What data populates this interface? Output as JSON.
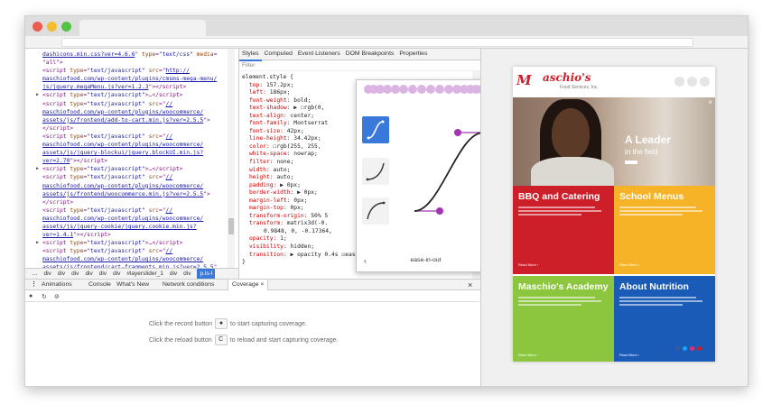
{
  "dom_lines": [
    {
      "tri": false,
      "html": "<span class='u'>dashicons.min.css?ver=4.6.6</span>\" <span class='a'>type</span>=<span class='v'>\"text/css\"</span> <span class='a'>media</span>="
    },
    {
      "tri": false,
      "html": "\"all\">"
    },
    {
      "tri": false,
      "html": "&lt;script <span class='a'>type</span>=<span class='v'>\"text/javascript\"</span> <span class='a'>src</span>=\"<span class='u'>http://</span>"
    },
    {
      "tri": false,
      "html": "<span class='u'>maschiofood.com/wp-content/plugins/cmsms-mega-menu/</span>"
    },
    {
      "tri": false,
      "html": "<span class='u'>js/jquery.megaMenu.js?ver=1.2.3</span>\">&lt;/script&gt;"
    },
    {
      "tri": true,
      "html": "&lt;script <span class='a'>type</span>=<span class='v'>\"text/javascript\"</span>&gt;…&lt;/script&gt;"
    },
    {
      "tri": false,
      "html": "&lt;script <span class='a'>type</span>=<span class='v'>\"text/javascript\"</span> <span class='a'>src</span>=\"<span class='u'>//</span>"
    },
    {
      "tri": false,
      "html": "<span class='u'>maschiofood.com/wp-content/plugins/woocommerce/</span>"
    },
    {
      "tri": false,
      "html": "<span class='u'>assets/js/frontend/add-to-cart.min.js?ver=2.5.5</span>\">"
    },
    {
      "tri": false,
      "html": "&lt;/script&gt;"
    },
    {
      "tri": false,
      "html": "&lt;script <span class='a'>type</span>=<span class='v'>\"text/javascript\"</span> <span class='a'>src</span>=\"<span class='u'>//</span>"
    },
    {
      "tri": false,
      "html": "<span class='u'>maschiofood.com/wp-content/plugins/woocommerce/</span>"
    },
    {
      "tri": false,
      "html": "<span class='u'>assets/js/jquery-blockui/jquery.blockUI.min.js?</span>"
    },
    {
      "tri": false,
      "html": "<span class='u'>ver=2.70</span>\">&lt;/script&gt;"
    },
    {
      "tri": true,
      "html": "&lt;script <span class='a'>type</span>=<span class='v'>\"text/javascript\"</span>&gt;…&lt;/script&gt;"
    },
    {
      "tri": false,
      "html": "&lt;script <span class='a'>type</span>=<span class='v'>\"text/javascript\"</span> <span class='a'>src</span>=\"<span class='u'>//</span>"
    },
    {
      "tri": false,
      "html": "<span class='u'>maschiofood.com/wp-content/plugins/woocommerce/</span>"
    },
    {
      "tri": false,
      "html": "<span class='u'>assets/js/frontend/woocommerce.min.js?ver=2.5.5</span>\">"
    },
    {
      "tri": false,
      "html": "&lt;/script&gt;"
    },
    {
      "tri": false,
      "html": "&lt;script <span class='a'>type</span>=<span class='v'>\"text/javascript\"</span> <span class='a'>src</span>=\"<span class='u'>//</span>"
    },
    {
      "tri": false,
      "html": "<span class='u'>maschiofood.com/wp-content/plugins/woocommerce/</span>"
    },
    {
      "tri": false,
      "html": "<span class='u'>assets/js/jquery-cookie/jquery.cookie.min.js?</span>"
    },
    {
      "tri": false,
      "html": "<span class='u'>ver=1.4.1</span>\">&lt;/script&gt;"
    },
    {
      "tri": true,
      "html": "&lt;script <span class='a'>type</span>=<span class='v'>\"text/javascript\"</span>&gt;…&lt;/script&gt;"
    },
    {
      "tri": false,
      "html": "&lt;script <span class='a'>type</span>=<span class='v'>\"text/javascript\"</span> <span class='a'>src</span>=\"<span class='u'>//</span>"
    },
    {
      "tri": false,
      "html": "<span class='u'>maschiofood.com/wp-content/plugins/woocommerce/</span>"
    },
    {
      "tri": false,
      "html": "<span class='u'>assets/js/frontend/cart-fragments.min.js?ver=2.5.5</span>\""
    }
  ],
  "breadcrumbs": [
    "…",
    "div",
    "div",
    "div",
    "div",
    "div",
    "div",
    "#layerslider_1",
    "div",
    "div",
    "p.ls-l"
  ],
  "styles_tabs": [
    "Styles",
    "Computed",
    "Event Listeners",
    "DOM Breakpoints",
    "Properties"
  ],
  "filter_placeholder": "Filter",
  "rule_selector": "element.style {",
  "rules": [
    {
      "p": "top",
      "v": "157.2px;"
    },
    {
      "p": "left",
      "v": "186px;"
    },
    {
      "p": "font-weight",
      "v": "bold;"
    },
    {
      "p": "text-shadow",
      "v": "▶ ☐rgb(0,"
    },
    {
      "p": "text-align",
      "v": "center;"
    },
    {
      "p": "font-family",
      "v": "Montserrat"
    },
    {
      "p": "font-size",
      "v": "42px;"
    },
    {
      "p": "line-height",
      "v": "34.42px;"
    },
    {
      "p": "color",
      "v": "☐rgb(255, 255,"
    },
    {
      "p": "white-space",
      "v": "nowrap;"
    },
    {
      "p": "filter",
      "v": "none;"
    },
    {
      "p": "width",
      "v": "auto;"
    },
    {
      "p": "height",
      "v": "auto;"
    },
    {
      "p": "padding",
      "v": "▶ 0px;"
    },
    {
      "p": "border-width",
      "v": "▶ 0px;"
    },
    {
      "p": "margin-left",
      "v": "0px;"
    },
    {
      "p": "margin-top",
      "v": "0px;"
    },
    {
      "p": "transform-origin",
      "v": "50% 5"
    },
    {
      "p": "transform",
      "v": "matrix3d(-0."
    },
    {
      "p": "",
      "v": "0.9848, 0, -0.17364,"
    },
    {
      "p": "opacity",
      "v": "1;"
    },
    {
      "p": "visibility",
      "v": "hidden;"
    },
    {
      "p": "transition",
      "v": "▶ opacity 0.4s ☑ease-in-out;"
    }
  ],
  "rule_close": "}",
  "bezier": {
    "preset_label": "ease-in-out",
    "prev": "‹",
    "next": "›",
    "accent": "#3879d9",
    "handle": "#a335b3"
  },
  "drawer_tabs": [
    "Animations",
    "Console",
    "What's New",
    "Network conditions",
    "Coverage"
  ],
  "drawer_close": "×",
  "coverage": {
    "record_pre": "Click the record button",
    "record_post": "to start capturing coverage.",
    "reload_pre": "Click the reload button",
    "reload_post": "to reload and start capturing coverage.",
    "record_glyph": "●",
    "reload_glyph": "C"
  },
  "site": {
    "logo_m": "M",
    "logo": "aschio's",
    "logo_sub": "Food Services, Inc.",
    "hero_title": "A Leader",
    "hero_sub": "in the field",
    "close": "×",
    "tiles": [
      {
        "title": "BBQ and Catering",
        "color": "#cc1f2a",
        "more": "Read More ›"
      },
      {
        "title": "School Menus",
        "color": "#f6b327",
        "more": "Read More ›"
      },
      {
        "title": "Maschio's Academy",
        "color": "#8cc63f",
        "more": "Read More ›"
      },
      {
        "title": "About Nutrition",
        "color": "#1a5bb8",
        "more": "Read More ›"
      }
    ],
    "social_colors": [
      "#3b5998",
      "#1da1f2",
      "#e1306c",
      "#cc1f2a"
    ]
  }
}
